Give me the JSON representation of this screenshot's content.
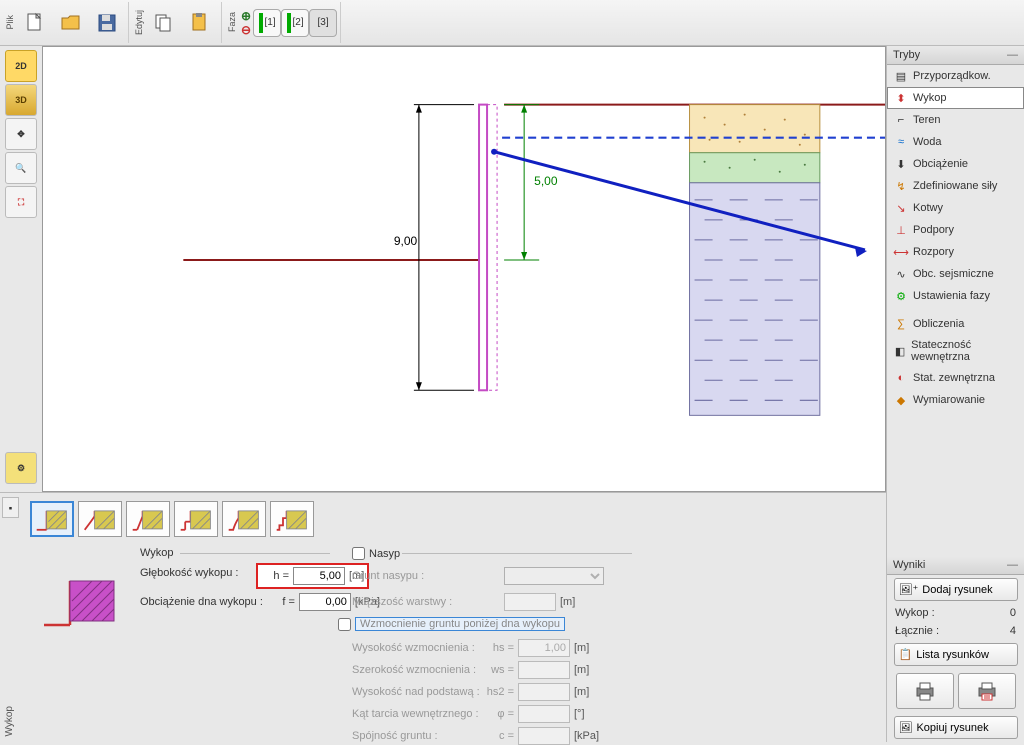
{
  "toolbar": {
    "file_label": "Plik",
    "edit_label": "Edytuj",
    "phase_label": "Faza",
    "phases": [
      "[1]",
      "[2]",
      "[3]"
    ],
    "active_phase": 2
  },
  "left_tools": {
    "view2d": "2D",
    "view3d": "3D"
  },
  "drawing": {
    "dim_total": "9,00",
    "dim_excav": "5,00"
  },
  "modes": {
    "title": "Tryby",
    "items": [
      {
        "label": "Przyporządkow.",
        "icon": "assign-icon"
      },
      {
        "label": "Wykop",
        "icon": "excavation-icon",
        "selected": true
      },
      {
        "label": "Teren",
        "icon": "terrain-icon"
      },
      {
        "label": "Woda",
        "icon": "water-icon"
      },
      {
        "label": "Obciążenie",
        "icon": "load-icon"
      },
      {
        "label": "Zdefiniowane siły",
        "icon": "force-icon"
      },
      {
        "label": "Kotwy",
        "icon": "anchor-icon"
      },
      {
        "label": "Podpory",
        "icon": "support-icon"
      },
      {
        "label": "Rozpory",
        "icon": "strut-icon"
      },
      {
        "label": "Obc. sejsmiczne",
        "icon": "seismic-icon"
      },
      {
        "label": "Ustawienia fazy",
        "icon": "settings-icon"
      }
    ],
    "calc_items": [
      {
        "label": "Obliczenia",
        "icon": "calc-icon"
      },
      {
        "label": "Stateczność wewnętrzna",
        "icon": "stab-int-icon"
      },
      {
        "label": "Stat. zewnętrzna",
        "icon": "stab-ext-icon"
      },
      {
        "label": "Wymiarowanie",
        "icon": "dim-icon"
      }
    ]
  },
  "results": {
    "title": "Wyniki",
    "add_drawing": "Dodaj rysunek",
    "row1_label": "Wykop :",
    "row1_val": "0",
    "row2_label": "Łącznie :",
    "row2_val": "4",
    "list_drawings": "Lista rysunków",
    "copy_drawing": "Kopiuj rysunek"
  },
  "form": {
    "section_wykop": "Wykop",
    "section_nasyp": "Nasyp",
    "depth_label": "Głębokość wykopu :",
    "depth_sym": "h =",
    "depth_val": "5,00",
    "depth_unit": "[m]",
    "load_label": "Obciążenie dna wykopu :",
    "load_sym": "f =",
    "load_val": "0,00",
    "load_unit": "[kPa]",
    "fill_soil_label": "Grunt nasypu :",
    "fill_thick_label": "Miąższość warstwy :",
    "fill_thick_unit": "[m]",
    "reinforce_label": "Wzmocnienie gruntu poniżej dna wykopu",
    "reinf_h_label": "Wysokość wzmocnienia :",
    "reinf_h_sym": "hs =",
    "reinf_h_val": "1,00",
    "reinf_h_unit": "[m]",
    "reinf_w_label": "Szerokość wzmocnienia :",
    "reinf_w_sym": "ws =",
    "reinf_w_unit": "[m]",
    "reinf_hab_label": "Wysokość nad podstawą :",
    "reinf_hab_sym": "hs2 =",
    "reinf_hab_unit": "[m]",
    "fric_label": "Kąt tarcia wewnętrznego :",
    "fric_sym": "φ =",
    "fric_unit": "[°]",
    "coh_label": "Spójność gruntu :",
    "coh_sym": "c =",
    "coh_unit": "[kPa]",
    "side_label": "Wykop"
  }
}
